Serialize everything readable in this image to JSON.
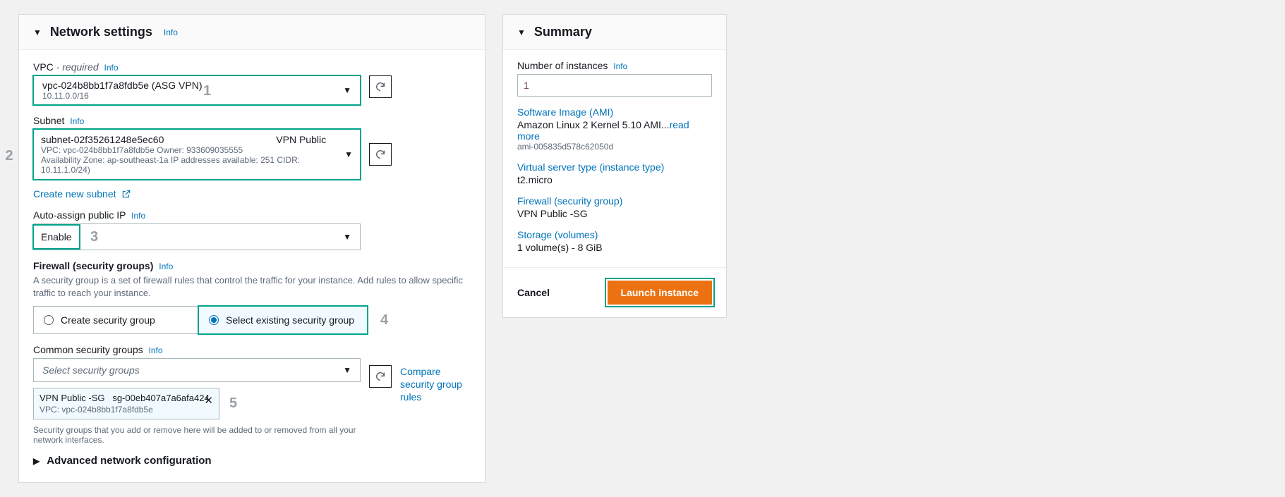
{
  "network": {
    "title": "Network settings",
    "info": "Info",
    "vpc": {
      "label": "VPC",
      "required": "- required",
      "info": "Info",
      "value": "vpc-024b8bb1f7a8fdb5e (ASG VPN)",
      "cidr": "10.11.0.0/16"
    },
    "subnet": {
      "label": "Subnet",
      "info": "Info",
      "id": "subnet-02f35261248e5ec60",
      "name": "VPN Public",
      "details": "VPC: vpc-024b8bb1f7a8fdb5e    Owner: 933609035555",
      "details2": "Availability Zone: ap-southeast-1a    IP addresses available: 251    CIDR: 10.11.1.0/24)",
      "create_link": "Create new subnet"
    },
    "auto_ip": {
      "label": "Auto-assign public IP",
      "info": "Info",
      "value": "Enable"
    },
    "firewall": {
      "label": "Firewall (security groups)",
      "info": "Info",
      "desc": "A security group is a set of firewall rules that control the traffic for your instance. Add rules to allow specific traffic to reach your instance.",
      "create_radio": "Create security group",
      "select_radio": "Select existing security group"
    },
    "common_sg": {
      "label": "Common security groups",
      "info": "Info",
      "placeholder": "Select security groups",
      "compare_link": "Compare security group rules",
      "token_name": "VPN Public -SG",
      "token_id": "sg-00eb407a7a6afa424",
      "token_vpc": "VPC: vpc-024b8bb1f7a8fdb5e",
      "help": "Security groups that you add or remove here will be added to or removed from all your network interfaces."
    },
    "advanced_toggle": "Advanced network configuration",
    "step1": "1",
    "step2": "2",
    "step3": "3",
    "step4": "4",
    "step5": "5"
  },
  "summary": {
    "title": "Summary",
    "num_label": "Number of instances",
    "info": "Info",
    "num_value": "1",
    "ami_label": "Software Image (AMI)",
    "ami_value_pre": "Amazon Linux 2 Kernel 5.10 AMI...",
    "read_more": "read more",
    "ami_id": "ami-005835d578c62050d",
    "type_label": "Virtual server type (instance type)",
    "type_value": "t2.micro",
    "fw_label": "Firewall (security group)",
    "fw_value": "VPN Public -SG",
    "storage_label": "Storage (volumes)",
    "storage_value": "1 volume(s) - 8 GiB",
    "cancel": "Cancel",
    "launch": "Launch instance"
  }
}
